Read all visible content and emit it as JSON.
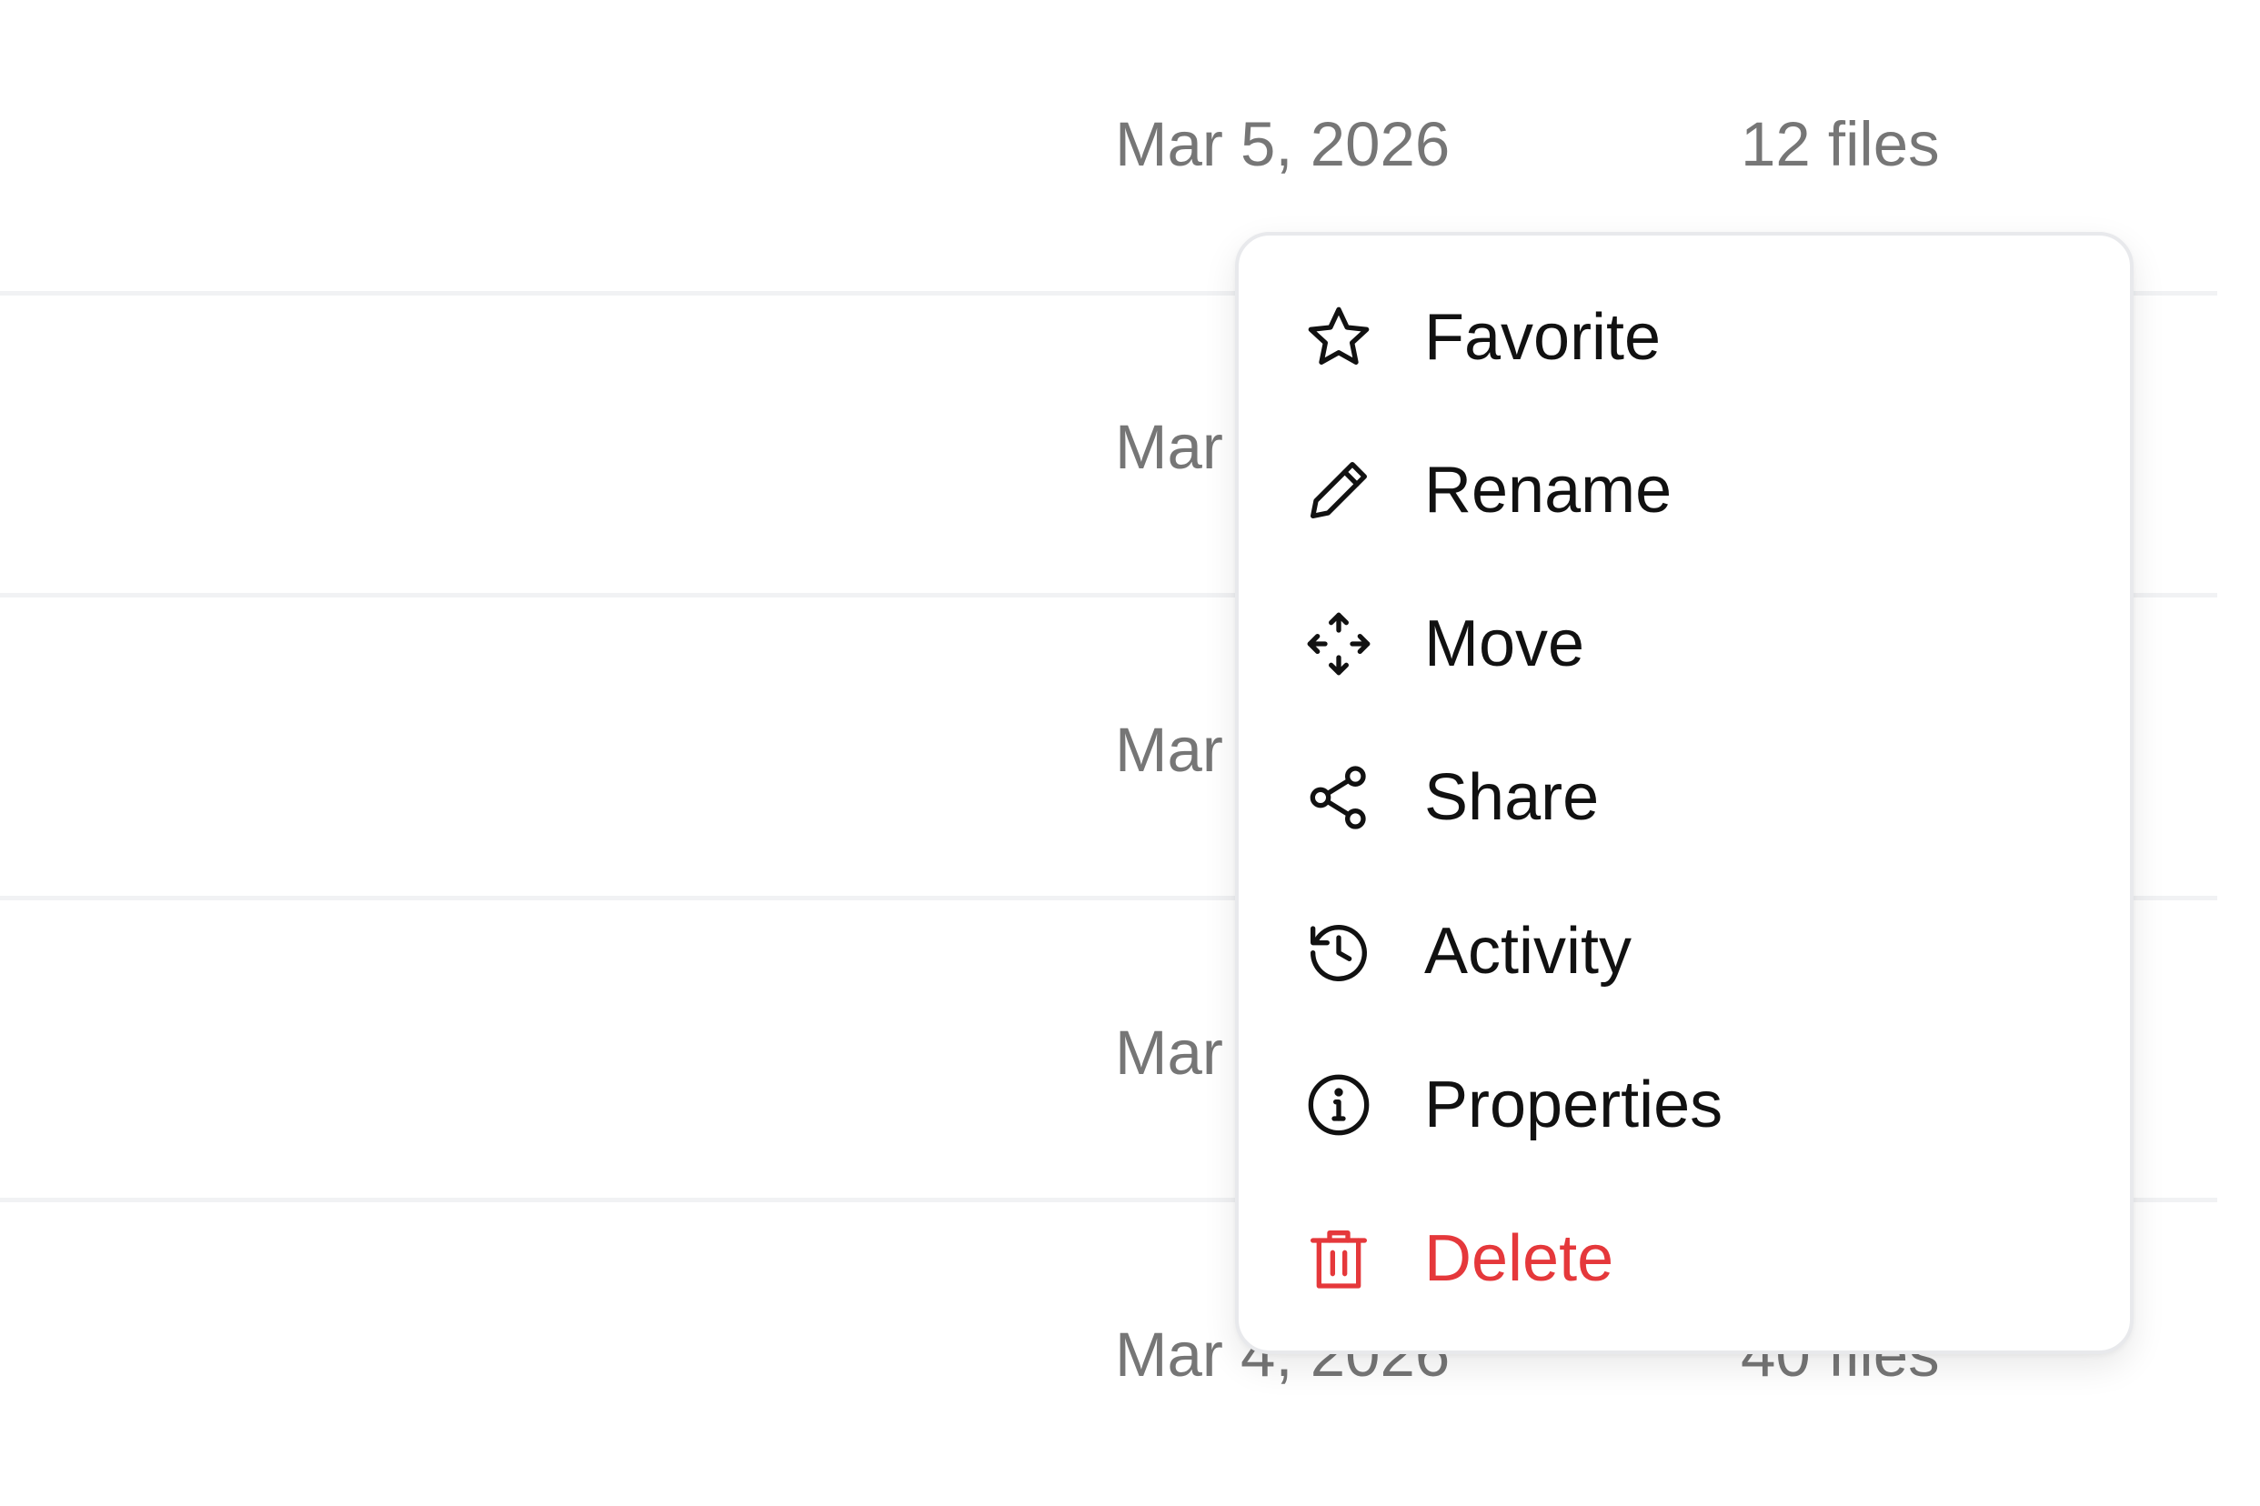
{
  "file_list": {
    "rows": [
      {
        "date": "Mar 5, 2026",
        "count": "12 files"
      },
      {
        "date": "Mar",
        "count": ""
      },
      {
        "date": "Mar",
        "count": ""
      },
      {
        "date": "Mar",
        "count": ""
      },
      {
        "date": "Mar 4, 2026",
        "count": "40 files"
      }
    ]
  },
  "context_menu": {
    "items": [
      {
        "label": "Favorite",
        "icon": "star-icon"
      },
      {
        "label": "Rename",
        "icon": "pencil-icon"
      },
      {
        "label": "Move",
        "icon": "move-icon"
      },
      {
        "label": "Share",
        "icon": "share-icon"
      },
      {
        "label": "Activity",
        "icon": "history-icon"
      },
      {
        "label": "Properties",
        "icon": "info-icon"
      },
      {
        "label": "Delete",
        "icon": "trash-icon"
      }
    ]
  },
  "colors": {
    "text": "#111111",
    "muted": "#767676",
    "danger": "#e5383b",
    "divider": "#f1f2f4",
    "menu_border": "#e8e9ec"
  }
}
